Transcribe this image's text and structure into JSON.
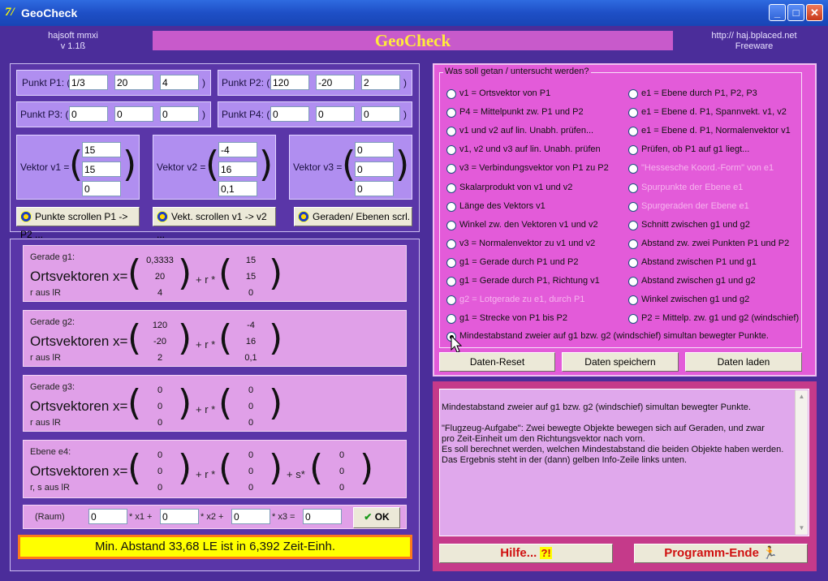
{
  "window": {
    "title": "GeoCheck",
    "app_icon": "7/"
  },
  "header": {
    "author": "hajsoft mmxi",
    "version": "v 1.1ß",
    "banner": "GeoCheck",
    "url": "http:// haj.bplaced.net",
    "license": "Freeware"
  },
  "points": [
    {
      "label": "Punkt P1:  (",
      "vals": [
        "1/3",
        "20",
        "4"
      ],
      "close": ")"
    },
    {
      "label": "Punkt P2:  (",
      "vals": [
        "120",
        "-20",
        "2"
      ],
      "close": ")"
    },
    {
      "label": "Punkt P3:  (",
      "vals": [
        "0",
        "0",
        "0"
      ],
      "close": ")"
    },
    {
      "label": "Punkt P4:  (",
      "vals": [
        "0",
        "0",
        "0"
      ],
      "close": ")"
    }
  ],
  "vectors": [
    {
      "label": "Vektor v1 =",
      "vals": [
        "15",
        "15",
        "0"
      ]
    },
    {
      "label": "Vektor v2 =",
      "vals": [
        "-4",
        "16",
        "0,1"
      ]
    },
    {
      "label": "Vektor v3 =",
      "vals": [
        "0",
        "0",
        "0"
      ]
    }
  ],
  "scroll_buttons": [
    "Punkte scrollen P1 -> P2 ...",
    "Vekt. scrollen v1 -> v2 ...",
    "Geraden/ Ebenen scrl."
  ],
  "lines": [
    {
      "title": "Gerade g1:",
      "ov": "Ortsvektoren x=",
      "domain": "r aus lR",
      "a": [
        "0,3333",
        "20",
        "4"
      ],
      "b": [
        "15",
        "15",
        "0"
      ],
      "mul": "+ r *"
    },
    {
      "title": "Gerade g2:",
      "ov": "Ortsvektoren x=",
      "domain": "r aus lR",
      "a": [
        "120",
        "-20",
        "2"
      ],
      "b": [
        "-4",
        "16",
        "0,1"
      ],
      "mul": "+ r *"
    },
    {
      "title": "Gerade g3:",
      "ov": "Ortsvektoren x=",
      "domain": "r aus lR",
      "a": [
        "0",
        "0",
        "0"
      ],
      "b": [
        "0",
        "0",
        "0"
      ],
      "mul": "+ r *"
    }
  ],
  "plane": {
    "title": "Ebene e4:",
    "ov": "Ortsvektoren x=",
    "domain": "r, s aus lR",
    "a": [
      "0",
      "0",
      "0"
    ],
    "b": [
      "0",
      "0",
      "0"
    ],
    "c": [
      "0",
      "0",
      "0"
    ],
    "mul1": "+ r *",
    "mul2": "+ s*"
  },
  "raum": {
    "label": "(Raum)",
    "vals": [
      "0",
      "0",
      "0",
      "0"
    ],
    "ops": [
      "* x1  +",
      "* x2  +",
      "* x3   ="
    ],
    "ok": "OK"
  },
  "status": "Min. Abstand 33,68 LE ist in 6,392 Zeit-Einh.",
  "options": {
    "legend": "Was soll getan / untersucht werden?",
    "left": [
      {
        "t": "v1 = Ortsvektor von P1"
      },
      {
        "t": "P4 = Mittelpunkt zw. P1 und P2"
      },
      {
        "t": "v1 und v2 auf lin. Unabh. prüfen..."
      },
      {
        "t": "v1, v2 und v3 auf lin. Unabh. prüfen"
      },
      {
        "t": "v3 = Verbindungsvektor von P1 zu P2"
      },
      {
        "t": "Skalarprodukt von v1 und v2"
      },
      {
        "t": "Länge des Vektors v1"
      },
      {
        "t": "Winkel zw. den Vektoren v1 und v2"
      },
      {
        "t": "v3 = Normalenvektor zu v1 und v2"
      },
      {
        "t": "g1 = Gerade durch P1 und P2"
      },
      {
        "t": "g1 = Gerade durch P1, Richtung v1"
      },
      {
        "t": "g2 = Lotgerade zu e1, durch P1",
        "dis": true
      },
      {
        "t": "g1 = Strecke von P1 bis P2"
      }
    ],
    "right": [
      {
        "t": "e1 = Ebene durch P1, P2, P3"
      },
      {
        "t": "e1 = Ebene d. P1, Spannvekt. v1, v2"
      },
      {
        "t": "e1 = Ebene d. P1, Normalenvektor v1"
      },
      {
        "t": "Prüfen, ob P1 auf g1 liegt..."
      },
      {
        "t": "\"Hessesche Koord.-Form\" von e1",
        "dis": true
      },
      {
        "t": "Spurpunkte der Ebene e1",
        "dis": true
      },
      {
        "t": "Spurgeraden der Ebene e1",
        "dis": true
      },
      {
        "t": "Schnitt zwischen g1 und g2"
      },
      {
        "t": "Abstand zw. zwei Punkten P1 und P2"
      },
      {
        "t": "Abstand zwischen P1 und g1"
      },
      {
        "t": "Abstand zwischen g1 und g2"
      },
      {
        "t": "Winkel zwischen g1 und g2"
      },
      {
        "t": "P2 = Mittelp. zw. g1 und g2 (windschief)"
      }
    ],
    "last": "Mindestabstand zweier auf g1 bzw. g2 (windschief) simultan bewegter Punkte."
  },
  "data_buttons": [
    "Daten-Reset",
    "Daten speichern",
    "Daten laden"
  ],
  "info_text": "Mindestabstand zweier auf g1 bzw. g2 (windschief) simultan bewegter Punkte.\n\n\"Flugzeug-Aufgabe\": Zwei bewegte Objekte bewegen sich auf Geraden, und zwar\npro Zeit-Einheit um den Richtungsvektor nach vorn.\nEs soll berechnet werden, welchen Mindestabstand die beiden Objekte haben werden.\nDas Ergebnis steht in der (dann) gelben Info-Zeile links unten.",
  "bottom_buttons": {
    "help": "Hilfe...",
    "end": "Programm-Ende"
  }
}
